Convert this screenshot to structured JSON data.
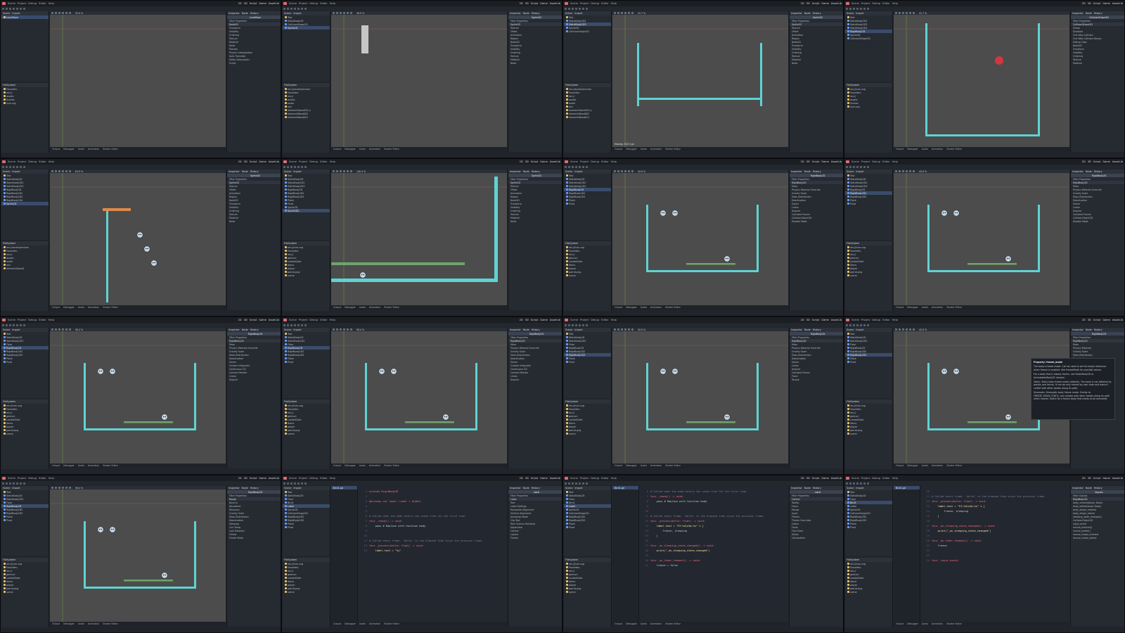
{
  "menu": [
    "Scene",
    "Project",
    "Debug",
    "Editor",
    "Help"
  ],
  "workspaces": [
    "2D",
    "3D",
    "Script",
    "Game",
    "AssetLib"
  ],
  "active_workspace": "2D",
  "panels": {
    "scene_title": "Scene",
    "import_title": "Import",
    "filesystem_title": "FileSystem",
    "inspector_title": "Inspector",
    "node_title": "Node",
    "history_title": "History"
  },
  "bottom_tabs": [
    "Output",
    "Debugger",
    "Audio",
    "Animation",
    "Shader Editor"
  ],
  "colors": {
    "accent": "#e06c75",
    "selection": "#3a4c6b",
    "wall": "#5fd3d3",
    "viewport_bg": "#4c4c4c",
    "panel_bg": "#262a31"
  },
  "frames": [
    {
      "kind": "viewport",
      "tree": [
        "LevelZone"
      ],
      "selected": 0,
      "files": [
        "Favorites:",
        "res://",
        "assets",
        "Scenes",
        "icon.svg"
      ],
      "inspector": [
        "LevelBase",
        "Filter Properties",
        "Node2D",
        "Transform",
        "Visibility",
        "Ordering",
        "Texture",
        "Material",
        "Node",
        "Process",
        "Physics Interpolation",
        "Auto Translate",
        "Editor Description",
        "Script"
      ],
      "viewport_kind": "empty",
      "zoom": "55.9 %"
    },
    {
      "kind": "viewport",
      "tree": [
        "Test",
        "StaticBody2D",
        "CollisionShape2D",
        "Sprite2D"
      ],
      "selected": 3,
      "files": [
        "res://assets/environ",
        "Favorites:",
        "res://",
        "assets",
        "audio",
        "env",
        "elementStone025.p",
        "elementWood002",
        "elementWood015"
      ],
      "inspector": [
        "Sprite2D",
        "Filter Properties",
        "Sprite2D",
        "Texture",
        "Offset",
        "Animation",
        "Region",
        "Node2D",
        "Transform",
        "Visibility",
        "Ordering",
        "Texture",
        "Material",
        "Node"
      ],
      "viewport_kind": "vertical-stick",
      "zoom": "56.9 %"
    },
    {
      "kind": "viewport",
      "tree": [
        "Test",
        "StaticBody2D2",
        "StaticBody2D3",
        "Sprite2D",
        "CollisionShape2D"
      ],
      "selected": 2,
      "files": [
        "res://assets/environ",
        "Favorites:",
        "res://",
        "assets",
        "audio",
        "env",
        "elementStone025.p",
        "elementWood002",
        "elementWood015"
      ],
      "inspector": [
        "Sprite2D",
        "Filter Properties",
        "Sprite2D",
        "Texture",
        "Offset",
        "Animation",
        "Region",
        "Node2D",
        "Transform",
        "Visibility",
        "Ordering",
        "Texture",
        "Material",
        "Node"
      ],
      "viewport_kind": "u-shape",
      "zoom": "41.7 %",
      "status": "Moving: 343.3 px"
    },
    {
      "kind": "viewport",
      "tree": [
        "Test",
        "StaticBody2D2",
        "StaticBody2D3",
        "StaticBody2D4",
        "RigidBody2D",
        "Sprite2D",
        "CollisionShape2D"
      ],
      "selected": 4,
      "files": [
        "res://icon.svg",
        "Favorites:",
        "res://",
        "assets",
        "Scenes",
        "icon.svg"
      ],
      "inspector": [
        "CollisionShape2D",
        "Filter Properties",
        "CollisionShape2D",
        "Shape",
        "Disabled",
        "One Way Collision",
        "One Way Collision Margin",
        "Debug Color",
        "Node2D",
        "Transform",
        "Visibility",
        "Ordering",
        "Texture",
        "Material"
      ],
      "viewport_kind": "box-with-ball",
      "zoom": "41.7 %"
    },
    {
      "kind": "viewport",
      "tree": [
        "Test",
        "StaticBody2D",
        "StaticBody2D2",
        "StaticBody2D3",
        "RigidBody2D",
        "RigidBody2D2",
        "RigidBody2D3",
        "RigidBody2D4",
        "Sprite2D"
      ],
      "selected": 8,
      "files": [
        "res://assets/environ",
        "Favorites:",
        "res://",
        "assets",
        "audio",
        "env",
        "elementStone0"
      ],
      "inspector": [
        "Sprite2D",
        "Filter Properties",
        "Sprite2D",
        "Texture",
        "Offset",
        "Animation",
        "Region",
        "Node2D",
        "Transform",
        "Visibility",
        "Ordering",
        "Texture",
        "Material",
        "Node"
      ],
      "viewport_kind": "plank-balls",
      "zoom": "63.9 %"
    },
    {
      "kind": "viewport",
      "tree": [
        "Test",
        "StaticBody2D",
        "StaticBody2D2",
        "StaticBody2D3",
        "RigidBody2D",
        "RigidBody2D2",
        "RigidBody2D3",
        "Plank",
        "Pivot",
        "Sprite2D",
        "Sprite2D2"
      ],
      "selected": 10,
      "files": [
        "res://icon.svg",
        "Favorites:",
        "res://",
        "gemuni",
        "LockedGate",
        "items",
        "player",
        "parrot.png",
        "scene"
      ],
      "inspector": [
        "Sprite2D",
        "Filter Properties",
        "Sprite2D",
        "Texture",
        "Offset",
        "Animation",
        "Region",
        "Node2D",
        "Transform",
        "Visibility",
        "Ordering",
        "Texture",
        "Material",
        "Node"
      ],
      "viewport_kind": "corner-ball",
      "zoom": "140.4 %"
    },
    {
      "kind": "viewport",
      "tree": [
        "Test",
        "StaticBody2D",
        "StaticBody2D2",
        "StaticBody2D3",
        "RigidBody2D",
        "RigidBody2D2",
        "RigidBody2D3",
        "Plank",
        "Pivot"
      ],
      "selected": 4,
      "files": [
        "res://icon.svg",
        "Favorites:",
        "res://",
        "gemuni",
        "LockedGate",
        "items",
        "player",
        "parrot.png",
        "scene"
      ],
      "inspector": [
        "RigidBody2D",
        "Filter Properties",
        "RigidBody2D",
        "Mass",
        "Physics Material Override",
        "Gravity Scale",
        "Mass Distribution",
        "Deactivation",
        "Solver",
        "Linear",
        "Angular",
        "Constant Forces",
        "CollisionObject2D",
        "Disable Mode"
      ],
      "viewport_kind": "box-balls",
      "zoom": "42.6 %"
    },
    {
      "kind": "viewport",
      "tree": [
        "Test",
        "StaticBody2D",
        "StaticBody2D2",
        "StaticBody2D3",
        "RigidBody2D",
        "RigidBody2D2",
        "RigidBody2D3",
        "Plank",
        "Pivot"
      ],
      "selected": 5,
      "files": [
        "res://icon.svg",
        "Favorites:",
        "res://",
        "gemuni",
        "LockedGate",
        "items",
        "player",
        "parrot.png",
        "scene"
      ],
      "inspector": [
        "RigidBody2D",
        "Filter Properties",
        "RigidBody2D",
        "Mass",
        "Physics Material Override",
        "Gravity Scale",
        "Mass Distribution",
        "Deactivation",
        "Solver",
        "Linear",
        "Angular",
        "Constant Forces",
        "CollisionObject2D",
        "Disable Mode"
      ],
      "viewport_kind": "box-balls",
      "zoom": "42.6 %"
    },
    {
      "kind": "viewport",
      "tree": [
        "Test",
        "StaticBody2D",
        "StaticBody2D2",
        "Floor",
        "RigidBody2D",
        "RigidBody2D2",
        "RigidBody2D3",
        "Plank",
        "Pivot"
      ],
      "selected": 4,
      "files": [
        "res://icon.svg",
        "Favorites:",
        "res://",
        "gemuni",
        "LockedGate",
        "items",
        "player",
        "parrot.png",
        "scene"
      ],
      "inspector": [
        "RigidBody2D",
        "Filter Properties",
        "RigidBody2D",
        "Mass",
        "Physics Material Override",
        "Gravity Scale",
        "Mass Distribution",
        "Deactivation",
        "Solver",
        "Custom Integrator",
        "Continuous CD",
        "Contact Monitor",
        "Linear",
        "Angular"
      ],
      "viewport_kind": "box-balls",
      "zoom": "56.4 %"
    },
    {
      "kind": "viewport",
      "tree": [
        "Test",
        "StaticBody2D",
        "StaticBody2D2",
        "Floor",
        "RigidBody2D",
        "RigidBody2D2",
        "RigidBody2D3",
        "Plank",
        "Pivot"
      ],
      "selected": 4,
      "files": [
        "res://icon.svg",
        "Favorites:",
        "res://",
        "gemuni",
        "LockedGate",
        "items",
        "player",
        "parrot.png",
        "scene"
      ],
      "inspector": [
        "RigidBody2D",
        "Filter Properties",
        "RigidBody2D",
        "Mass",
        "Physics Material Override",
        "Gravity Scale",
        "Mass Distribution",
        "Deactivation",
        "Solver",
        "Custom Integrator",
        "Continuous CD",
        "Contact Monitor",
        "Linear",
        "Angular"
      ],
      "viewport_kind": "box-balls",
      "zoom": "56.4 %"
    },
    {
      "kind": "viewport",
      "tree": [
        "Test",
        "StaticBody2D",
        "StaticBody2D2",
        "Floor",
        "RigidBody2D",
        "RigidBody2D2",
        "RigidBody2D3",
        "Plank",
        "Pivot"
      ],
      "selected": 6,
      "files": [
        "res://icon.svg",
        "Favorites:",
        "res://",
        "gemuni",
        "LockedGate",
        "items",
        "player",
        "parrot.png",
        "scene"
      ],
      "inspector": [
        "RigidBody2D",
        "Filter Properties",
        "RigidBody2D",
        "Mass",
        "Physics Material Override",
        "Gravity Scale",
        "Mass Distribution",
        "Deactivation",
        "Solver",
        "Linear",
        "Angular",
        "Constant Forces",
        "Force",
        "Torque"
      ],
      "viewport_kind": "box-balls",
      "zoom": "42.6 %"
    },
    {
      "kind": "viewport",
      "tree": [
        "Test",
        "StaticBody2D",
        "StaticBody2D2",
        "Floor",
        "RigidBody2D",
        "RigidBody2D2",
        "RigidBody2D3",
        "Plank",
        "Pivot"
      ],
      "selected": 6,
      "files": [
        "res://icon.svg",
        "Favorites:",
        "res://",
        "gemuni",
        "LockedGate",
        "items",
        "player",
        "parrot.png",
        "scene"
      ],
      "inspector": [
        "RigidBody2D",
        "Filter Properties",
        "RigidBody2D",
        "Mass",
        "Physics Material",
        "Gravity Scale",
        "Mass Distribution",
        "Deactivation",
        "Solver",
        "Linear",
        "Angular",
        "Constant Forces",
        "CollisionObject2D",
        "Disable Mode"
      ],
      "viewport_kind": "box-balls",
      "zoom": "42.6 %",
      "tooltip": {
        "title": "Property: freeze_mode",
        "body": [
          "The body's freeze mode. Can be used to set the body's behavior when freeze is enabled. See FreezeMode for possible values.",
          "For a body that is always frozen, use StaticBody2D or AnimatableBody2D instead.",
          "Static: Static body freeze mode (default). The body is not affected by gravity and forces. It can be only moved by user code and doesn't collide with other bodies along its path.",
          "Kinematic: Kinematic body freeze mode. Similar to FREEZE_MODE_STATIC, but collides with other bodies along its path when moved. Useful for a frozen body that needs to be animated."
        ]
      }
    },
    {
      "kind": "viewport",
      "tree": [
        "Test",
        "StaticBody2D",
        "StaticBody2D2",
        "Floor",
        "RigidBody2D",
        "RigidBody2D2",
        "RigidBody2D3",
        "Plank",
        "Pivot"
      ],
      "selected": 4,
      "files": [
        "res://icon.svg",
        "Favorites:",
        "res://",
        "gemuni",
        "LockedGate",
        "items",
        "player",
        "parrot.png",
        "scene"
      ],
      "inspector": [
        "RigidBody2D",
        "Filter Properties",
        "Rough",
        "Bounce",
        "Absorbent",
        "Resource",
        "Gravity Scale",
        "Mass Distribution",
        "Deactivation",
        "Sleeping",
        "Can Sleep",
        "Lock Rotation",
        "Freeze",
        "Freeze Mode"
      ],
      "viewport_kind": "box-balls",
      "zoom": "56.4 %"
    },
    {
      "kind": "script",
      "tree": [
        "Test",
        "StaticBody2D",
        "Floor",
        "Bird1",
        "Label",
        "Sprite2D",
        "CollisionShape2D",
        "RigidBody2D2",
        "RigidBody2D3",
        "Plank",
        "Pivot"
      ],
      "selected": 4,
      "files": [
        "res://icon.svg",
        "Favorites:",
        "res://",
        "gemuni",
        "LockedGate",
        "items",
        "player",
        "parrot.png",
        "scene"
      ],
      "inspector": [
        "Label",
        "Filter Properties",
        "Label",
        "Text",
        "Label Settings",
        "Horizontal Alignment",
        "Vertical Alignment",
        "Autowrap Mode",
        "Clip Text",
        "Text Overrun Behavior",
        "Uppercase",
        "Control",
        "Layout",
        "Theme"
      ],
      "script_list": [
        "Bird1.gd"
      ],
      "code": [
        [
          "1",
          "extends RigidBody2D"
        ],
        [
          "2",
          ""
        ],
        [
          "3",
          "@onready var label: Label = $Label"
        ],
        [
          "4",
          ""
        ],
        [
          "5",
          ""
        ],
        [
          "6",
          "# Called when the node enters the scene tree for the first time."
        ],
        [
          "7",
          "func _ready() -> void:"
        ],
        [
          "8",
          "    pass # Replace with function body."
        ],
        [
          "9",
          ""
        ],
        [
          "10",
          ""
        ],
        [
          "11",
          "# Called every frame. 'delta' is the elapsed time since the previous frame."
        ],
        [
          "12",
          "func _process(delta: float) -> void:"
        ],
        [
          "13",
          "    label.text = \"%s\""
        ]
      ]
    },
    {
      "kind": "script",
      "tree": [
        "Test",
        "StaticBody2D",
        "Floor",
        "Bird1",
        "Label",
        "Sprite2D",
        "CollisionShape2D",
        "RigidBody2D2",
        "RigidBody2D3",
        "Plank",
        "Pivot"
      ],
      "selected": 4,
      "files": [
        "res://icon.svg",
        "Favorites:",
        "res://",
        "gemuni",
        "LockedGate",
        "items",
        "player",
        "parrot.png",
        "scene"
      ],
      "inspector": [
        "Label",
        "Filter Properties",
        "Control",
        "Tooltip",
        "Focus",
        "Mouse",
        "Input",
        "Theme",
        "Theme Overrides",
        "Colors",
        "Fonts",
        "Font Sizes",
        "Styles",
        "CanvasItem"
      ],
      "script_list": [
        "Bird1.gd"
      ],
      "code": [
        [
          "6",
          "# Called when the node enters the scene tree for the first time."
        ],
        [
          "7",
          "func _ready() -> void:"
        ],
        [
          "8",
          "    pass # Replace with function body."
        ],
        [
          "9",
          ""
        ],
        [
          "10",
          ""
        ],
        [
          "11",
          "# Called every frame. 'delta' is the elapsed time since the previous frame."
        ],
        [
          "12",
          "func _process(delta: float) -> void:"
        ],
        [
          "13",
          "    label.text = \"F2:%d\\n%b:%s\" % ["
        ],
        [
          "14",
          "        freeze, sleeping"
        ],
        [
          "15",
          "    ]"
        ],
        [
          "16",
          ""
        ],
        [
          "17",
          "func _on_sleeping_state_changed() -> void:"
        ],
        [
          "18",
          "    print(\"_on_sleeping_state_changed\")"
        ],
        [
          "19",
          ""
        ],
        [
          "20",
          "func _on_timer_timeout() -> void:"
        ],
        [
          "21",
          "    freeze = false"
        ]
      ]
    },
    {
      "kind": "script",
      "tree": [
        "Test",
        "StaticBody2D",
        "Floor",
        "Bird1",
        "Label",
        "Sprite2D",
        "CollisionShape2D",
        "RigidBody2D2",
        "RigidBody2D3",
        "Plank",
        "Pivot"
      ],
      "selected": 3,
      "files": [
        "res://icon.svg",
        "Favorites:",
        "res://",
        "gemuni",
        "LockedGate",
        "items",
        "player",
        "parrot.png",
        "scene"
      ],
      "inspector": [
        "Signals",
        "Filter Signals",
        "RigidBody2D",
        "body_entered(body: Node)",
        "body_exited(body: Node)",
        "body_shape_entered",
        "body_shape_exited",
        "sleeping_state_changed()",
        "CollisionObject2D",
        "input_event",
        "mouse_entered()",
        "mouse_exited()",
        "mouse_shape_entered",
        "mouse_shape_exited"
      ],
      "script_list": [
        "Bird1.gd"
      ],
      "code": [
        [
          "10",
          ""
        ],
        [
          "11",
          "# Called every frame. 'delta' is the elapsed time since the previous frame."
        ],
        [
          "12",
          "func _process(delta: float) -> void:"
        ],
        [
          "13",
          "    label.text = \"F2:%d\\n%b:%s\" % ["
        ],
        [
          "14",
          "        freeze, sleeping"
        ],
        [
          "15",
          "    ]"
        ],
        [
          "16",
          ""
        ],
        [
          "17",
          "func _on_sleeping_state_changed() -> void:"
        ],
        [
          "18",
          "    print(\"_on_sleeping_state_changed\")"
        ],
        [
          "19",
          ""
        ],
        [
          "20",
          "func _on_timer_timeout() -> void:"
        ],
        [
          "21",
          "    freeze"
        ],
        [
          "22",
          ""
        ],
        [
          "23",
          ""
        ],
        [
          "24",
          "func _input_event("
        ]
      ]
    }
  ]
}
